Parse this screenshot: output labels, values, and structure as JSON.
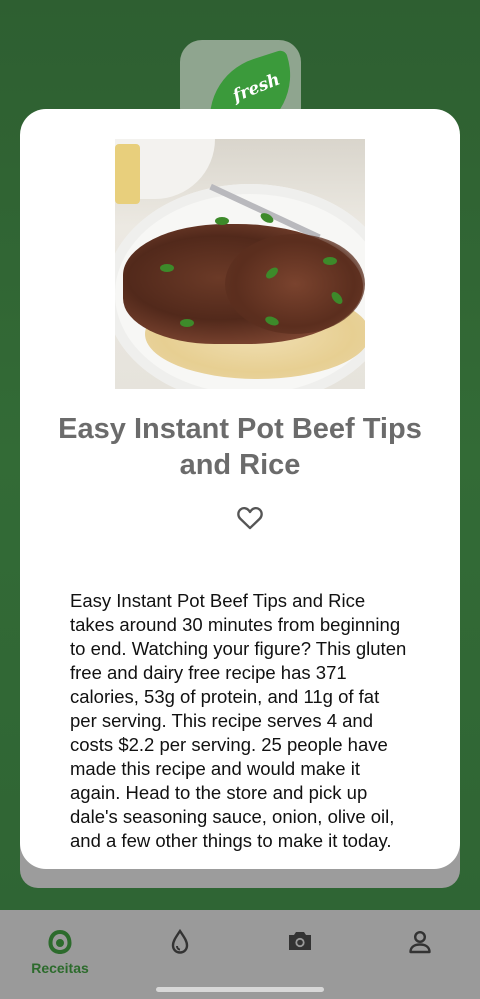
{
  "logo": {
    "text": "fresh"
  },
  "recipe": {
    "title": "Easy Instant Pot Beef Tips and Rice",
    "image_alt": "Beef tips over rice on a white plate",
    "description": "Easy Instant Pot Beef Tips and Rice takes around 30 minutes from beginning to end. Watching your figure? This gluten free and dairy free recipe has 371 calories, 53g of protein, and 11g of fat per serving. This recipe serves 4 and costs $2.2 per serving. 25 people have made this recipe and would make it again. Head to the store and pick up dale's seasoning sauce, onion, olive oil, and a few other things to make it today.",
    "favorite_icon": "heart-outline-icon"
  },
  "nav": {
    "items": [
      {
        "label": "Receitas",
        "icon": "recipes-icon",
        "active": true
      },
      {
        "label": "",
        "icon": "water-drop-icon",
        "active": false
      },
      {
        "label": "",
        "icon": "camera-icon",
        "active": false
      },
      {
        "label": "",
        "icon": "profile-icon",
        "active": false
      }
    ]
  },
  "colors": {
    "background": "#2f6333",
    "accent": "#2c6b2c",
    "title": "#6b6b6b",
    "navbar": "#9a9a9a"
  }
}
